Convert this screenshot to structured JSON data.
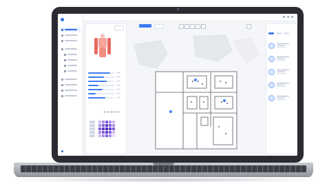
{
  "device": {
    "kind": "laptop-mockup"
  },
  "app": {
    "brand_color": "#2f6fe4",
    "accent_color": "#3d7bf0",
    "sidebar": {
      "items": [
        {
          "icon": "dashboard-icon",
          "active": true
        },
        {
          "icon": "people-icon",
          "active": false
        },
        {
          "icon": "device-icon",
          "active": false
        },
        {
          "icon": "location-icon",
          "active": false
        },
        {
          "icon": "list-icon",
          "active": false,
          "sub": true
        },
        {
          "icon": "list-icon",
          "active": false,
          "sub": true
        },
        {
          "icon": "list-icon",
          "active": false,
          "sub": true
        },
        {
          "icon": "list-icon",
          "active": false,
          "sub": true
        },
        {
          "icon": "report-icon",
          "active": false
        },
        {
          "icon": "calendar-icon",
          "active": false
        },
        {
          "icon": "settings-icon",
          "active": false
        },
        {
          "icon": "help-icon",
          "active": false
        }
      ],
      "footer_icon": "user-avatar-icon"
    },
    "left_panel": {
      "progress_bars": [
        0.85,
        0.6,
        0.72,
        0.4,
        0.55,
        0.3,
        0.65
      ],
      "matrix_colors": [
        [
          "#c9b7f2",
          "#a98be8",
          "#7d5bd8",
          "#a98be8",
          "#c9b7f2"
        ],
        [
          "#a98be8",
          "#7d5bd8",
          "#5b37c7",
          "#7d5bd8",
          "#a98be8"
        ],
        [
          "#7d5bd8",
          "#5b37c7",
          "#4322b0",
          "#5b37c7",
          "#7d5bd8"
        ],
        [
          "#a98be8",
          "#7d5bd8",
          "#5b37c7",
          "#7d5bd8",
          "#c9b7f2"
        ],
        [
          "#c9b7f2",
          "#a98be8",
          "#7d5bd8",
          "#a98be8",
          "#e3d9fa"
        ]
      ]
    },
    "right_panel": {
      "items": [
        {
          "icon": "person-pin-icon"
        },
        {
          "icon": "person-pin-icon"
        },
        {
          "icon": "person-pin-icon"
        },
        {
          "icon": "person-pin-icon"
        },
        {
          "icon": "person-pin-icon"
        }
      ]
    }
  }
}
